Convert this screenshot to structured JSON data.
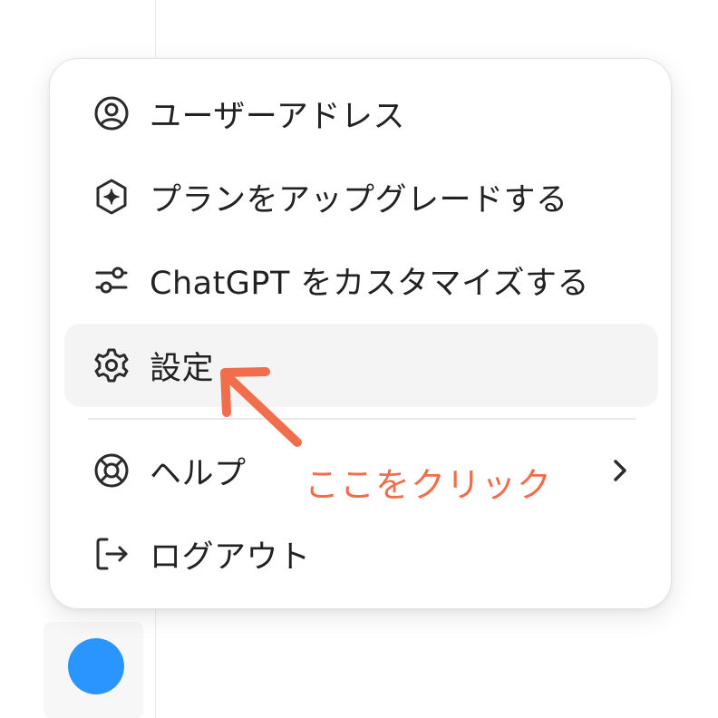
{
  "menu": {
    "items": [
      {
        "label": "ユーザーアドレス",
        "icon": "user-circle-icon"
      },
      {
        "label": "プランをアップグレードする",
        "icon": "upgrade-sparkle-icon"
      },
      {
        "label": "ChatGPT をカスタマイズする",
        "icon": "sliders-icon"
      },
      {
        "label": "設定",
        "icon": "gear-icon"
      },
      {
        "label": "ヘルプ",
        "icon": "lifebuoy-icon"
      },
      {
        "label": "ログアウト",
        "icon": "logout-icon"
      }
    ],
    "active_index": 3
  },
  "annotation": {
    "text": "ここをクリック"
  },
  "colors": {
    "annotation": "#f06e4c",
    "avatar": "#2b95ff",
    "active_bg": "#f4f4f4"
  }
}
